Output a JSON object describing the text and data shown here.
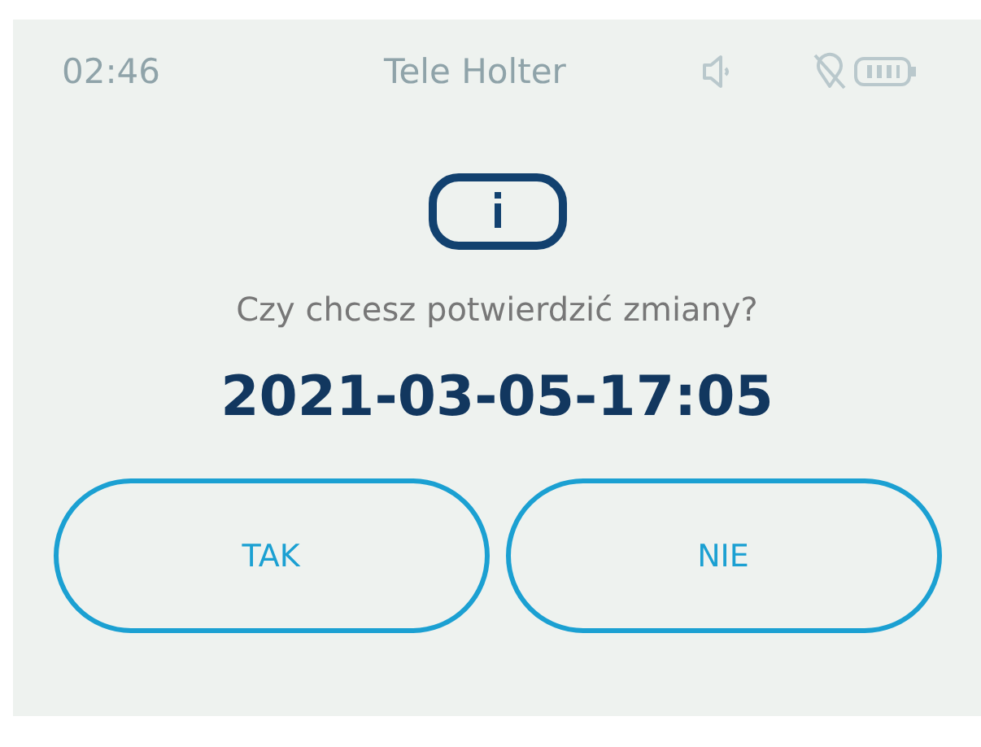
{
  "status_bar": {
    "time": "02:46",
    "title": "Tele Holter"
  },
  "dialog": {
    "message": "Czy chcesz potwierdzić zmiany?",
    "value": "2021-03-05-17:05"
  },
  "buttons": [
    {
      "label": "TAK"
    },
    {
      "label": "NIE"
    }
  ]
}
